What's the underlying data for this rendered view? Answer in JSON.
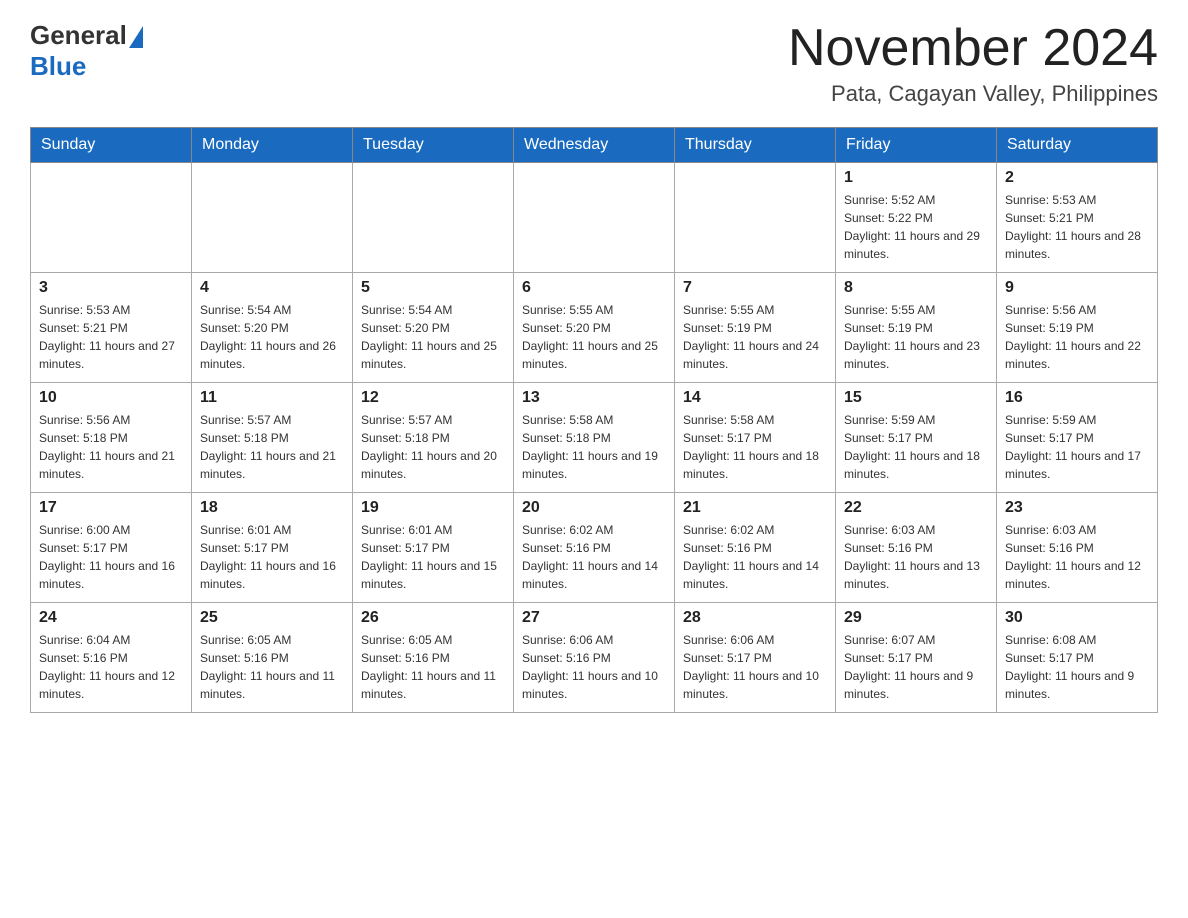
{
  "header": {
    "logo_general": "General",
    "logo_blue": "Blue",
    "title": "November 2024",
    "location": "Pata, Cagayan Valley, Philippines"
  },
  "weekdays": [
    "Sunday",
    "Monday",
    "Tuesday",
    "Wednesday",
    "Thursday",
    "Friday",
    "Saturday"
  ],
  "weeks": [
    [
      {
        "day": "",
        "info": ""
      },
      {
        "day": "",
        "info": ""
      },
      {
        "day": "",
        "info": ""
      },
      {
        "day": "",
        "info": ""
      },
      {
        "day": "",
        "info": ""
      },
      {
        "day": "1",
        "info": "Sunrise: 5:52 AM\nSunset: 5:22 PM\nDaylight: 11 hours and 29 minutes."
      },
      {
        "day": "2",
        "info": "Sunrise: 5:53 AM\nSunset: 5:21 PM\nDaylight: 11 hours and 28 minutes."
      }
    ],
    [
      {
        "day": "3",
        "info": "Sunrise: 5:53 AM\nSunset: 5:21 PM\nDaylight: 11 hours and 27 minutes."
      },
      {
        "day": "4",
        "info": "Sunrise: 5:54 AM\nSunset: 5:20 PM\nDaylight: 11 hours and 26 minutes."
      },
      {
        "day": "5",
        "info": "Sunrise: 5:54 AM\nSunset: 5:20 PM\nDaylight: 11 hours and 25 minutes."
      },
      {
        "day": "6",
        "info": "Sunrise: 5:55 AM\nSunset: 5:20 PM\nDaylight: 11 hours and 25 minutes."
      },
      {
        "day": "7",
        "info": "Sunrise: 5:55 AM\nSunset: 5:19 PM\nDaylight: 11 hours and 24 minutes."
      },
      {
        "day": "8",
        "info": "Sunrise: 5:55 AM\nSunset: 5:19 PM\nDaylight: 11 hours and 23 minutes."
      },
      {
        "day": "9",
        "info": "Sunrise: 5:56 AM\nSunset: 5:19 PM\nDaylight: 11 hours and 22 minutes."
      }
    ],
    [
      {
        "day": "10",
        "info": "Sunrise: 5:56 AM\nSunset: 5:18 PM\nDaylight: 11 hours and 21 minutes."
      },
      {
        "day": "11",
        "info": "Sunrise: 5:57 AM\nSunset: 5:18 PM\nDaylight: 11 hours and 21 minutes."
      },
      {
        "day": "12",
        "info": "Sunrise: 5:57 AM\nSunset: 5:18 PM\nDaylight: 11 hours and 20 minutes."
      },
      {
        "day": "13",
        "info": "Sunrise: 5:58 AM\nSunset: 5:18 PM\nDaylight: 11 hours and 19 minutes."
      },
      {
        "day": "14",
        "info": "Sunrise: 5:58 AM\nSunset: 5:17 PM\nDaylight: 11 hours and 18 minutes."
      },
      {
        "day": "15",
        "info": "Sunrise: 5:59 AM\nSunset: 5:17 PM\nDaylight: 11 hours and 18 minutes."
      },
      {
        "day": "16",
        "info": "Sunrise: 5:59 AM\nSunset: 5:17 PM\nDaylight: 11 hours and 17 minutes."
      }
    ],
    [
      {
        "day": "17",
        "info": "Sunrise: 6:00 AM\nSunset: 5:17 PM\nDaylight: 11 hours and 16 minutes."
      },
      {
        "day": "18",
        "info": "Sunrise: 6:01 AM\nSunset: 5:17 PM\nDaylight: 11 hours and 16 minutes."
      },
      {
        "day": "19",
        "info": "Sunrise: 6:01 AM\nSunset: 5:17 PM\nDaylight: 11 hours and 15 minutes."
      },
      {
        "day": "20",
        "info": "Sunrise: 6:02 AM\nSunset: 5:16 PM\nDaylight: 11 hours and 14 minutes."
      },
      {
        "day": "21",
        "info": "Sunrise: 6:02 AM\nSunset: 5:16 PM\nDaylight: 11 hours and 14 minutes."
      },
      {
        "day": "22",
        "info": "Sunrise: 6:03 AM\nSunset: 5:16 PM\nDaylight: 11 hours and 13 minutes."
      },
      {
        "day": "23",
        "info": "Sunrise: 6:03 AM\nSunset: 5:16 PM\nDaylight: 11 hours and 12 minutes."
      }
    ],
    [
      {
        "day": "24",
        "info": "Sunrise: 6:04 AM\nSunset: 5:16 PM\nDaylight: 11 hours and 12 minutes."
      },
      {
        "day": "25",
        "info": "Sunrise: 6:05 AM\nSunset: 5:16 PM\nDaylight: 11 hours and 11 minutes."
      },
      {
        "day": "26",
        "info": "Sunrise: 6:05 AM\nSunset: 5:16 PM\nDaylight: 11 hours and 11 minutes."
      },
      {
        "day": "27",
        "info": "Sunrise: 6:06 AM\nSunset: 5:16 PM\nDaylight: 11 hours and 10 minutes."
      },
      {
        "day": "28",
        "info": "Sunrise: 6:06 AM\nSunset: 5:17 PM\nDaylight: 11 hours and 10 minutes."
      },
      {
        "day": "29",
        "info": "Sunrise: 6:07 AM\nSunset: 5:17 PM\nDaylight: 11 hours and 9 minutes."
      },
      {
        "day": "30",
        "info": "Sunrise: 6:08 AM\nSunset: 5:17 PM\nDaylight: 11 hours and 9 minutes."
      }
    ]
  ]
}
